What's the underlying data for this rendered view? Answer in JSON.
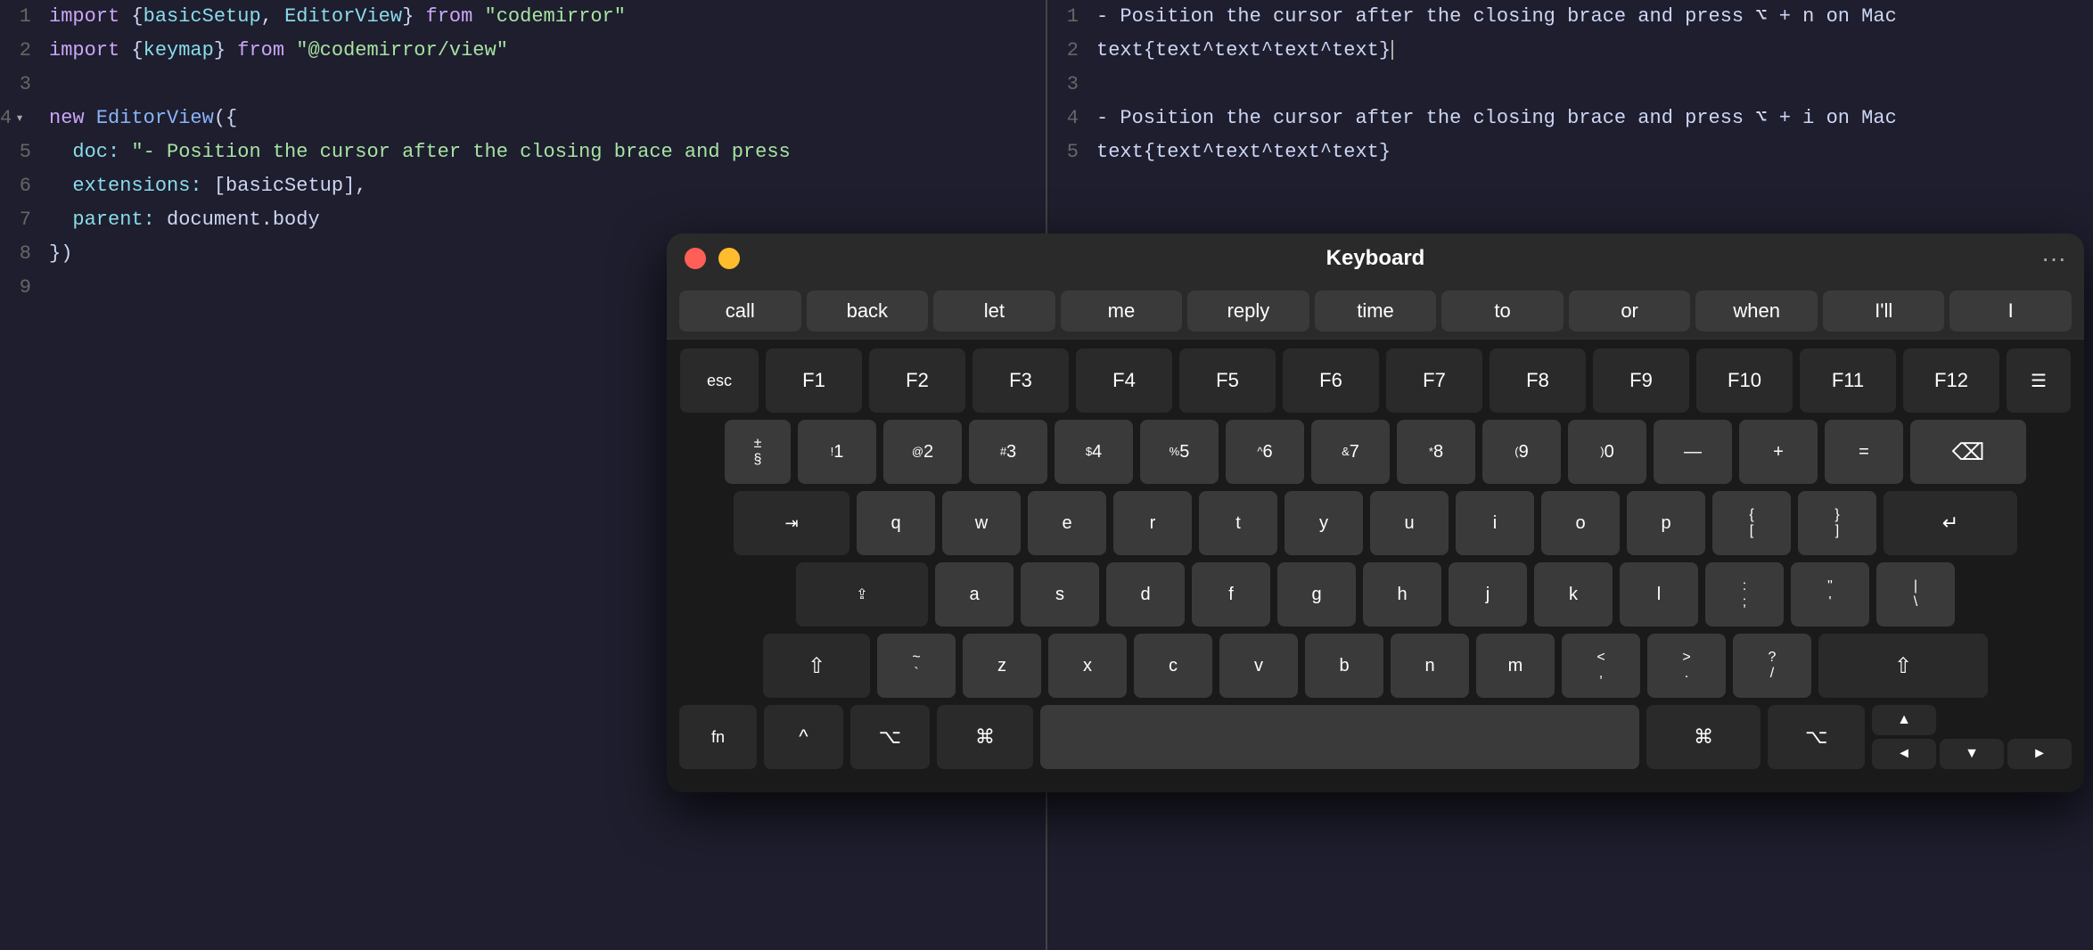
{
  "editors": {
    "left": {
      "lines": [
        {
          "num": 1,
          "tokens": [
            {
              "text": "import ",
              "class": "kw-import"
            },
            {
              "text": "{",
              "class": "bracket"
            },
            {
              "text": "basicSetup",
              "class": "kw-green"
            },
            {
              "text": ", ",
              "class": ""
            },
            {
              "text": "EditorView",
              "class": "kw-green"
            },
            {
              "text": "} ",
              "class": "bracket"
            },
            {
              "text": "from ",
              "class": "kw-from"
            },
            {
              "text": "\"codemirror\"",
              "class": "str-val"
            }
          ]
        },
        {
          "num": 2,
          "tokens": [
            {
              "text": "import ",
              "class": "kw-import"
            },
            {
              "text": "{",
              "class": "bracket"
            },
            {
              "text": "keymap",
              "class": "kw-green"
            },
            {
              "text": "} ",
              "class": "bracket"
            },
            {
              "text": "from ",
              "class": "kw-from"
            },
            {
              "text": "\"@codemirror/view\"",
              "class": "str-val"
            }
          ]
        },
        {
          "num": 3,
          "tokens": []
        },
        {
          "num": 4,
          "tokens": [
            {
              "text": "new ",
              "class": "kw-new"
            },
            {
              "text": "EditorView",
              "class": "kw-blue"
            },
            {
              "text": "({",
              "class": "bracket"
            }
          ],
          "collapsed": true
        },
        {
          "num": 5,
          "tokens": [
            {
              "text": "  doc: ",
              "class": "kw-property"
            },
            {
              "text": "\"- Position the cursor after the closing brace and press",
              "class": "str-val"
            }
          ],
          "indent": true
        },
        {
          "num": 6,
          "tokens": [
            {
              "text": "  extensions: ",
              "class": "kw-property"
            },
            {
              "text": "[basicSetup],",
              "class": "bracket"
            }
          ],
          "indent": true
        },
        {
          "num": 7,
          "tokens": [
            {
              "text": "  parent: ",
              "class": "kw-property"
            },
            {
              "text": "document.body",
              "class": "right-code"
            }
          ],
          "indent": true
        },
        {
          "num": 8,
          "tokens": [
            {
              "text": "})",
              "class": "bracket"
            }
          ]
        },
        {
          "num": 9,
          "tokens": []
        }
      ]
    },
    "right": {
      "lines": [
        {
          "num": 1,
          "text": "- Position the cursor after the closing brace and press ⌥ + n on Mac"
        },
        {
          "num": 2,
          "text": "text{text^text^text^text}",
          "cursor": true
        },
        {
          "num": 3,
          "text": ""
        },
        {
          "num": 4,
          "text": "- Position the cursor after the closing brace and press ⌥ + i on Mac"
        },
        {
          "num": 5,
          "text": "text{text^text^text^text}"
        }
      ]
    }
  },
  "keyboard": {
    "title": "Keyboard",
    "suggestions": [
      "call",
      "back",
      "let",
      "me",
      "reply",
      "time",
      "to",
      "or",
      "when",
      "I'll",
      "I"
    ],
    "rows": {
      "function": [
        "esc",
        "F1",
        "F2",
        "F3",
        "F4",
        "F5",
        "F6",
        "F7",
        "F8",
        "F9",
        "F10",
        "F11",
        "F12",
        "☰"
      ],
      "numbers": [
        "±§",
        "!1",
        "@2",
        "#3",
        "$4",
        "%5",
        "^6",
        "&7",
        "*8",
        "(9",
        ")0",
        "—",
        "+",
        "=",
        "⌫"
      ],
      "qwerty_tab": "⇥",
      "qwerty": [
        "q",
        "w",
        "e",
        "r",
        "t",
        "y",
        "u",
        "i",
        "o",
        "p",
        "{[",
        "}]",
        "↵"
      ],
      "asdf_caps": "⇪",
      "asdf": [
        "a",
        "s",
        "d",
        "f",
        "g",
        "h",
        "j",
        "k",
        "l",
        ":;",
        "\"'",
        "|\\"
      ],
      "zxcv_shift_left": "⇧",
      "zxcv": [
        "z",
        "x",
        "c",
        "v",
        "b",
        "n",
        "m",
        "<,",
        ">,",
        ".>",
        "?/",
        "⇧"
      ],
      "bottom": {
        "fn": "fn",
        "ctrl": "^",
        "opt": "⌥",
        "cmd_left": "⌘",
        "space": "",
        "cmd_right": "⌘",
        "opt_right": "⌥",
        "arrows": [
          "▲",
          "◄",
          "▼",
          "►"
        ]
      }
    }
  }
}
